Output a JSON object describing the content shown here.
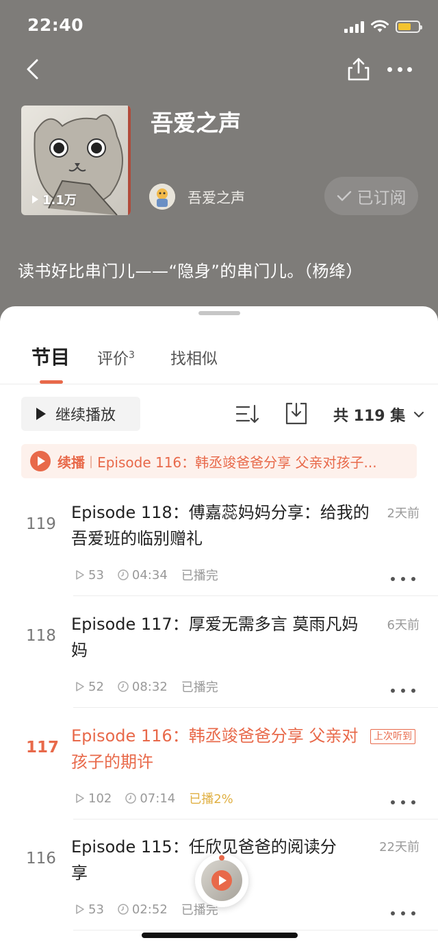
{
  "status": {
    "time": "22:40",
    "battery_color": "#f4c430"
  },
  "header": {
    "back_icon": "chevron-left-icon",
    "share_icon": "share-icon",
    "more_icon": "more-icon"
  },
  "album": {
    "title": "吾爱之声",
    "play_count": "1.1万",
    "author": "吾爱之声",
    "subscribe_label": "已订阅",
    "description": "读书好比串门儿——“隐身”的串门儿。（杨绛）"
  },
  "tabs": {
    "programs": "节目",
    "reviews": "评价",
    "reviews_count": "3",
    "similar": "找相似"
  },
  "toolbar": {
    "continue_label": "继续播放",
    "total_label": "共 119 集"
  },
  "resume": {
    "label": "续播",
    "text": "Episode 116：韩丞竣爸爸分享 父亲对孩子..."
  },
  "episodes": [
    {
      "num": "119",
      "title": "Episode 118：傅嘉蕊妈妈分享：给我的吾爱班的临别赠礼",
      "date": "2天前",
      "plays": "53",
      "duration": "04:34",
      "status": "已播完"
    },
    {
      "num": "118",
      "title": "Episode 117：厚爱无需多言 莫雨凡妈妈",
      "date": "6天前",
      "plays": "52",
      "duration": "08:32",
      "status": "已播完"
    },
    {
      "num": "117",
      "title": "Episode 116：韩丞竣爸爸分享 父亲对孩子的期许",
      "badge": "上次听到",
      "plays": "102",
      "duration": "07:14",
      "status": "已播2%"
    },
    {
      "num": "116",
      "title": "Episode 115：任欣见爸爸的阅读分享",
      "date": "22天前",
      "plays": "53",
      "duration": "02:52",
      "status": "已播完"
    }
  ],
  "colors": {
    "accent": "#e8694a",
    "header_bg": "#7e7c79"
  }
}
